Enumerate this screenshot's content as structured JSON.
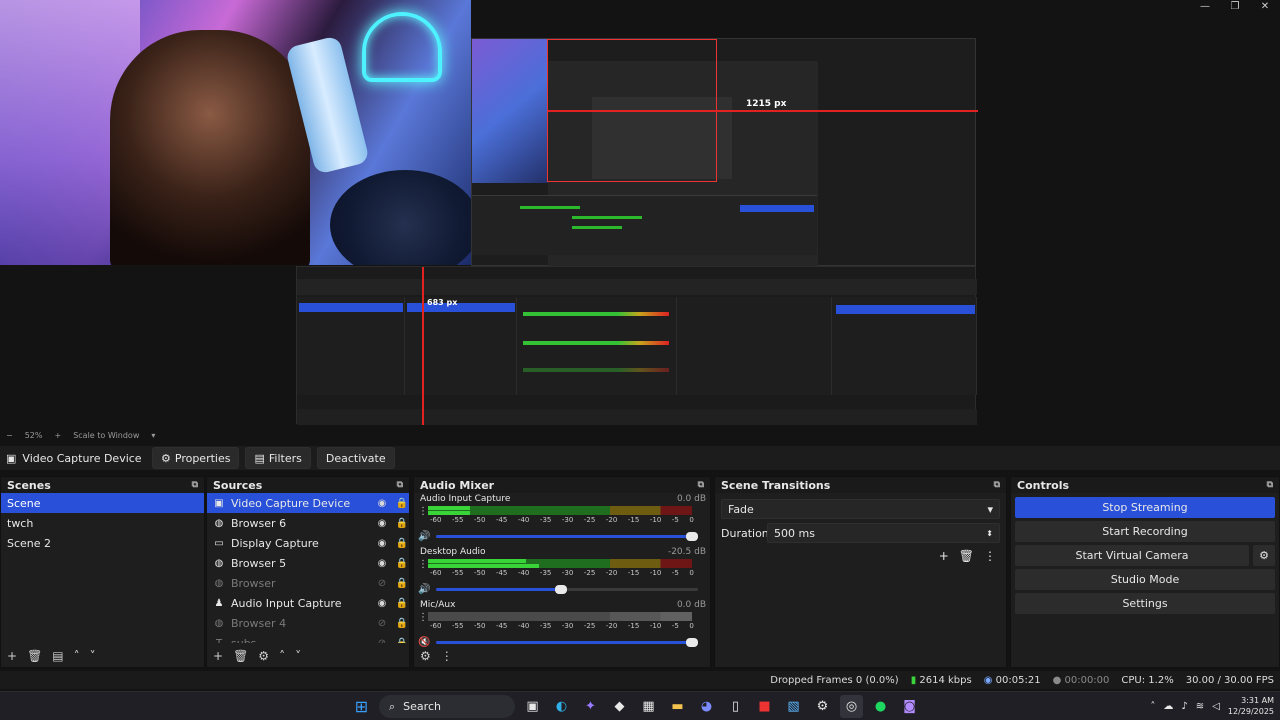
{
  "window_controls": {
    "minimize": "—",
    "maximize": "❐",
    "close": "✕"
  },
  "preview": {
    "measure_h": "1215 px",
    "measure_v": "683 px",
    "zoom": "52%",
    "scale_mode": "Scale to Window"
  },
  "context_bar": {
    "source": "Video Capture Device",
    "properties": "Properties",
    "filters": "Filters",
    "deactivate": "Deactivate"
  },
  "scenes": {
    "title": "Scenes",
    "items": [
      {
        "label": "Scene",
        "selected": true
      },
      {
        "label": "twch",
        "selected": false
      },
      {
        "label": "Scene 2",
        "selected": false
      }
    ]
  },
  "sources": {
    "title": "Sources",
    "items": [
      {
        "label": "Video Capture Device",
        "icon": "camera-icon",
        "glyph": "▣",
        "visible": true
      },
      {
        "label": "Browser 6",
        "icon": "globe-icon",
        "glyph": "◍",
        "visible": true
      },
      {
        "label": "Display Capture",
        "icon": "monitor-icon",
        "glyph": "▭",
        "visible": true
      },
      {
        "label": "Browser 5",
        "icon": "globe-icon",
        "glyph": "◍",
        "visible": true
      },
      {
        "label": "Browser",
        "icon": "globe-icon",
        "glyph": "◍",
        "visible": false
      },
      {
        "label": "Audio Input Capture",
        "icon": "microphone-icon",
        "glyph": "♟",
        "visible": true
      },
      {
        "label": "Browser 4",
        "icon": "globe-icon",
        "glyph": "◍",
        "visible": false
      },
      {
        "label": "subs",
        "icon": "text-icon",
        "glyph": "T",
        "visible": false
      }
    ]
  },
  "audio_mixer": {
    "title": "Audio Mixer",
    "ticks": [
      "-60",
      "-55",
      "-50",
      "-45",
      "-40",
      "-35",
      "-30",
      "-25",
      "-20",
      "-15",
      "-10",
      "-5",
      "0"
    ],
    "channels": [
      {
        "name": "Audio Input Capture",
        "db": "0.0 dB",
        "level": 0.16,
        "level2": 0.16,
        "volume": 1.0,
        "muted": false
      },
      {
        "name": "Desktop Audio",
        "db": "-20.5 dB",
        "level": 0.37,
        "level2": 0.42,
        "volume": 0.5,
        "muted": false
      },
      {
        "name": "Mic/Aux",
        "db": "0.0 dB",
        "level": 0.0,
        "level2": 0.0,
        "volume": 1.0,
        "muted": true
      }
    ]
  },
  "transitions": {
    "title": "Scene Transitions",
    "selected": "Fade",
    "duration_label": "Duration",
    "duration_value": "500 ms"
  },
  "controls": {
    "title": "Controls",
    "stop_streaming": "Stop Streaming",
    "start_recording": "Start Recording",
    "start_virtual_camera": "Start Virtual Camera",
    "studio_mode": "Studio Mode",
    "settings": "Settings"
  },
  "status": {
    "dropped": "Dropped Frames 0 (0.0%)",
    "bitrate": "2614 kbps",
    "stream_time": "00:05:21",
    "record_time": "00:00:00",
    "cpu": "CPU: 1.2%",
    "fps": "30.00 / 30.00 FPS"
  },
  "taskbar": {
    "search": "Search",
    "time": "3:31 AM",
    "date": "12/29/2025"
  },
  "colors": {
    "accent": "#2850d8",
    "meter_green": "#38d438",
    "measure_red": "#e02222"
  }
}
